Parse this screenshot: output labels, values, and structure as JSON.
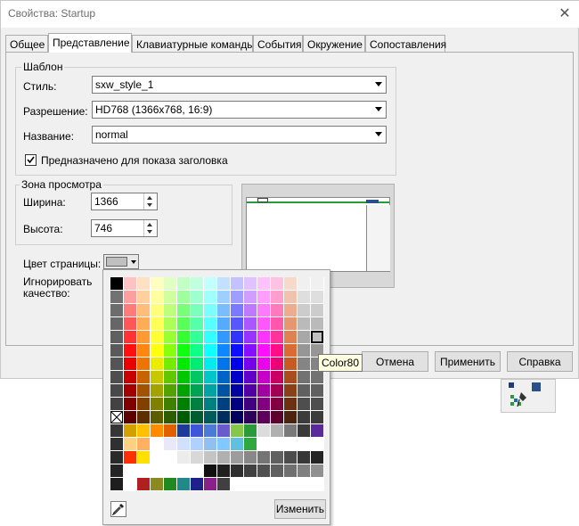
{
  "window": {
    "title": "Свойства: Startup",
    "close_glyph": "✕"
  },
  "tabs": [
    {
      "label": "Общее",
      "active": false
    },
    {
      "label": "Представление",
      "active": true
    },
    {
      "label": "Клавиатурные команды",
      "active": false
    },
    {
      "label": "События",
      "active": false
    },
    {
      "label": "Окружение",
      "active": false
    },
    {
      "label": "Сопоставления",
      "active": false
    }
  ],
  "template_group": {
    "legend": "Шаблон",
    "style_label": "Стиль:",
    "style_value": "sxw_style_1",
    "resolution_label": "Разрешение:",
    "resolution_value": "HD768 (1366x768, 16:9)",
    "name_label": "Название:",
    "name_value": "normal",
    "header_checkbox_label": "Предназначено для показа заголовка",
    "header_checkbox_checked": true
  },
  "view_zone": {
    "legend": "Зона просмотра",
    "width_label": "Ширина:",
    "width_value": "1366",
    "height_label": "Высота:",
    "height_value": "746"
  },
  "page_color": {
    "label": "Цвет страницы:",
    "value": "#c0c0c0"
  },
  "ignore_quality": {
    "label_line1": "Игнорировать",
    "label_line2": "качество:"
  },
  "buttons": {
    "cancel": "Отмена",
    "apply": "Применить",
    "help": "Справка"
  },
  "palette": {
    "tooltip": "Color80",
    "change_button": "Изменить",
    "eyedropper_icon": "eyedropper-icon",
    "selected_color": "#c0c0c0"
  },
  "colors": {
    "accent_green": "#2b9a3a",
    "tab_border": "#adadad",
    "dialog_bg": "#f0f0f0"
  }
}
